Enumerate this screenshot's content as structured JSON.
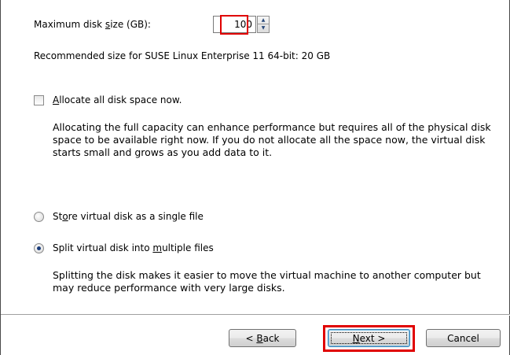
{
  "disk": {
    "max_size_label_pre": "Maximum disk ",
    "max_size_label_u": "s",
    "max_size_label_post": "ize (GB):",
    "max_size_value": "100",
    "recommended_text": "Recommended size for SUSE Linux Enterprise 11 64-bit: 20 GB"
  },
  "allocate": {
    "label_u": "A",
    "label_rest": "llocate all disk space now.",
    "checked": false,
    "description": "Allocating the full capacity can enhance performance but requires all of the physical disk space to be available right now. If you do not allocate all the space now, the virtual disk starts small and grows as you add data to it."
  },
  "storage_options": {
    "single_pre": "St",
    "single_u": "o",
    "single_post": "re virtual disk as a single file",
    "split_pre": "Split virtual disk into ",
    "split_u": "m",
    "split_post": "ultiple files",
    "selected": "split",
    "split_description": "Splitting the disk makes it easier to move the virtual machine to another computer but may reduce performance with very large disks."
  },
  "buttons": {
    "back_pre": "< ",
    "back_u": "B",
    "back_post": "ack",
    "next_u": "N",
    "next_post": "ext >",
    "cancel": "Cancel"
  },
  "colors": {
    "highlight": "#e00000",
    "radio_dot": "#1a3c7a"
  }
}
